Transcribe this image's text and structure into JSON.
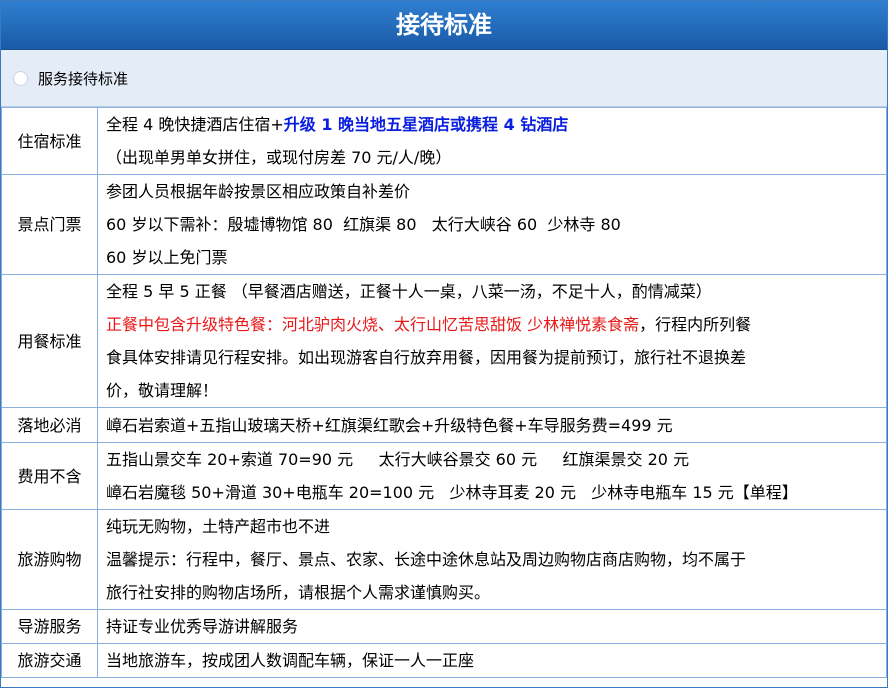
{
  "title": "接待标准",
  "section_label": "服务接待标准",
  "rows": {
    "lodging": {
      "label": "住宿标准",
      "line1_normal": "全程 4 晚快捷酒店住宿+",
      "line1_upgrade": "升级 1 晚当地五星酒店或携程 4 钻酒店",
      "line2": "（出现单男单女拼住，或现付房差 70 元/人/晚）"
    },
    "tickets": {
      "label": "景点门票",
      "line1": "参团人员根据年龄按景区相应政策自补差价",
      "line2": "60 岁以下需补：殷墟博物馆 80  红旗渠 80   太行大峡谷 60  少林寺 80",
      "line3": "60 岁以上免门票"
    },
    "meals": {
      "label": "用餐标准",
      "line1": "全程 5 早 5 正餐 （早餐酒店赠送，正餐十人一桌，八菜一汤，不足十人，酌情减菜）",
      "line2_red": "正餐中包含升级特色餐：河北驴肉火烧、太行山忆苦思甜饭 少林禅悦素食斋",
      "line2_normal": "，行程内所列餐",
      "line3": "食具体安排请见行程安排。如出现游客自行放弃用餐，因用餐为提前预订，旅行社不退换差",
      "line4": "价，敬请理解！"
    },
    "mandatory": {
      "label": "落地必消",
      "line1": "嶂石岩索道+五指山玻璃天桥+红旗渠红歌会+升级特色餐+车导服务费=499 元"
    },
    "excluded": {
      "label": "费用不含",
      "line1": "五指山景交车 20+索道 70=90 元     太行大峡谷景交 60 元     红旗渠景交 20 元",
      "line2": "嶂石岩魔毯 50+滑道 30+电瓶车 20=100 元   少林寺耳麦 20 元   少林寺电瓶车 15 元【单程】"
    },
    "shopping": {
      "label": "旅游购物",
      "line1": "纯玩无购物，土特产超市也不进",
      "line2": "温馨提示：行程中，餐厅、景点、农家、长途中途休息站及周边购物店商店购物，均不属于",
      "line3": "旅行社安排的购物店场所，请根据个人需求谨慎购买。"
    },
    "guide": {
      "label": "导游服务",
      "line1": "持证专业优秀导游讲解服务"
    },
    "transport": {
      "label": "旅游交通",
      "line1": "当地旅游车，按成团人数调配车辆，保证一人一正座"
    }
  },
  "colors": {
    "title_bg": "#1f6bbd",
    "border": "#8bb0db",
    "section_bg": "#e4ecf7",
    "upgrade_blue": "#0a1ee0",
    "highlight_red": "#e81818"
  }
}
